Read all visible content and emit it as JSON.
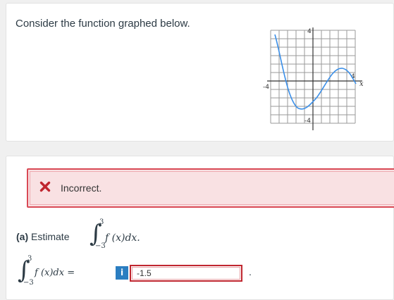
{
  "question": {
    "prompt": "Consider the function graphed below."
  },
  "graph": {
    "y_top_label": "4",
    "y_bottom_label": "-4",
    "x_left_label": "-4",
    "x_right_label": "4",
    "x_axis_name": "x",
    "curve_color": "#3b8fe8"
  },
  "feedback": {
    "status_icon": "x-icon",
    "status_text": "Incorrect.",
    "status_color": "#d94955"
  },
  "part_a": {
    "label": "(a)",
    "verb": "Estimate",
    "integrand": "f (x)dx.",
    "upper_limit": "3",
    "lower_limit": "−3"
  },
  "answer": {
    "integrand": "f (x)dx =",
    "upper_limit": "3",
    "lower_limit": "−3",
    "info_label": "i",
    "value": "-1.5",
    "trailing": "."
  }
}
